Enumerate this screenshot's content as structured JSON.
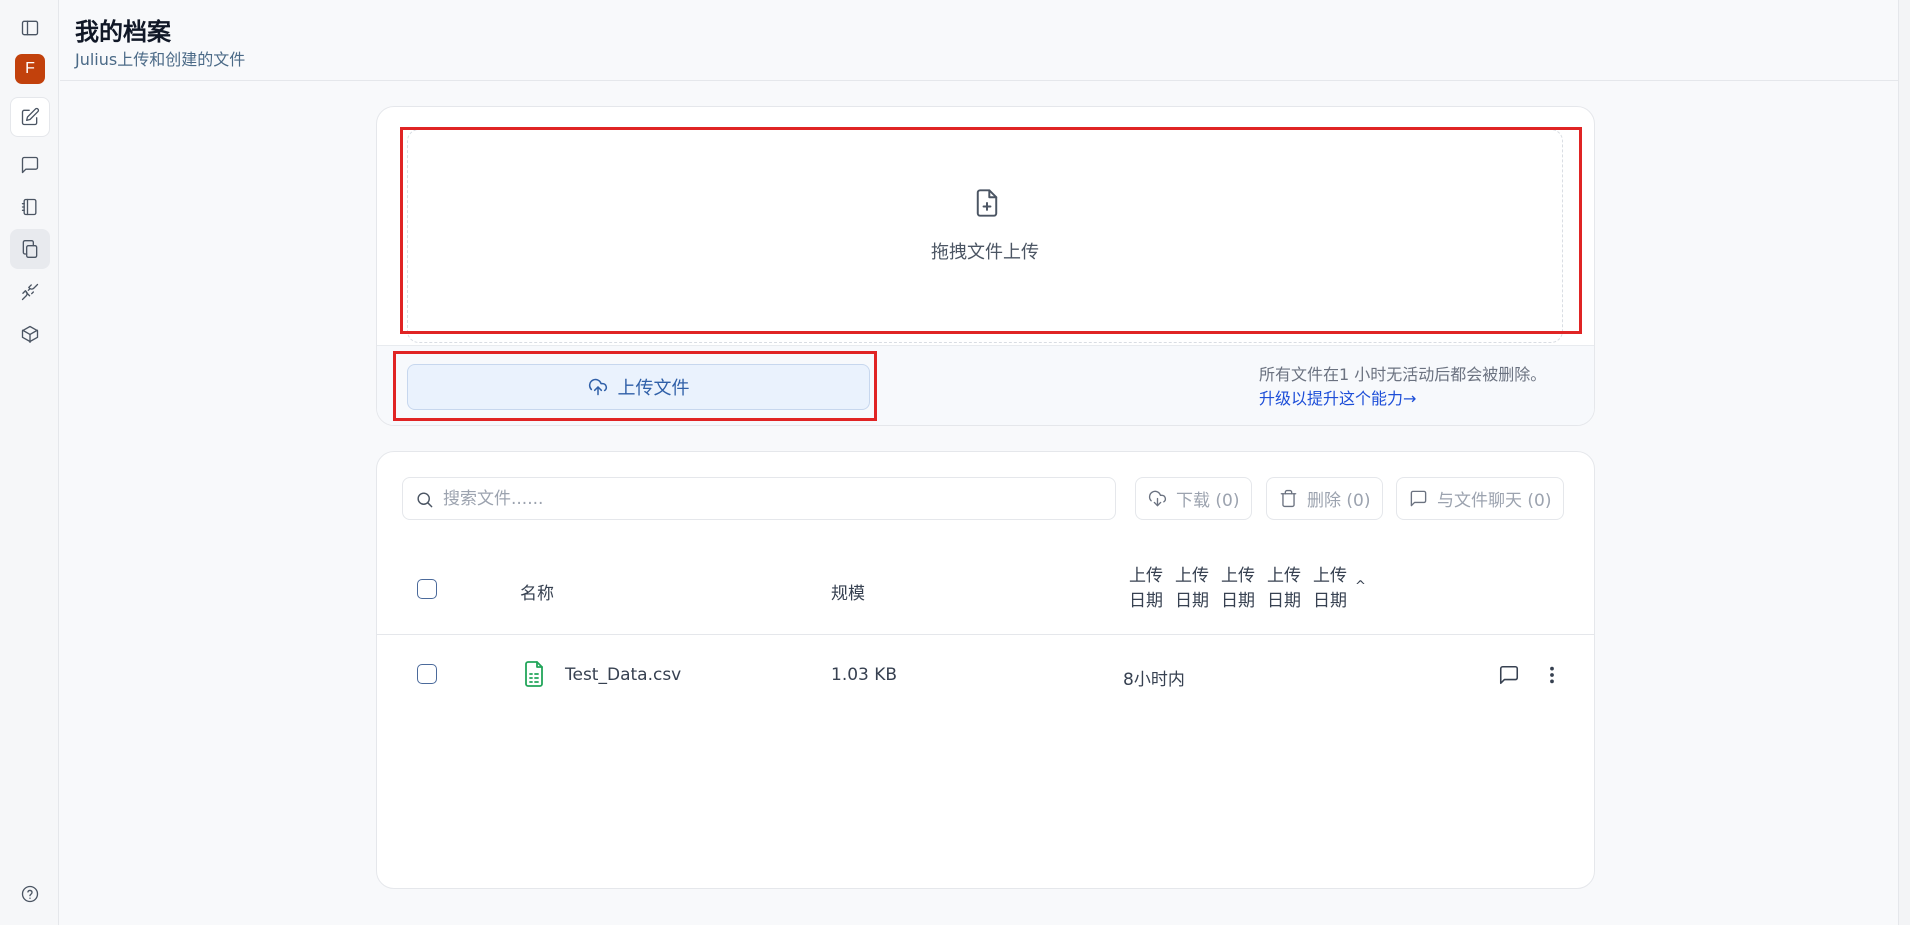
{
  "header": {
    "title": "我的档案",
    "subtitle": "Julius上传和创建的文件"
  },
  "sidebar": {
    "avatar_letter": "F",
    "avatar_color": "#c2410c"
  },
  "upload": {
    "dropzone_text": "拖拽文件上传",
    "upload_button_label": "上传文件",
    "notice": "所有文件在1 小时无活动后都会被删除。",
    "upgrade_link": "升级以提升这个能力→"
  },
  "files": {
    "search_placeholder": "搜索文件......",
    "download_label": "下载 (0)",
    "delete_label": "删除 (0)",
    "chat_label": "与文件聊天 (0)",
    "columns": {
      "name": "名称",
      "size": "规模",
      "date_line1": "上传",
      "date_line2": "日期"
    },
    "sort_indicator": "^",
    "rows": [
      {
        "name": "Test_Data.csv",
        "size": "1.03 KB",
        "date": "8小时内"
      }
    ]
  },
  "colors": {
    "accent": "#2f5fa8",
    "highlight": "#e02424",
    "csv_icon": "#22a55a"
  }
}
